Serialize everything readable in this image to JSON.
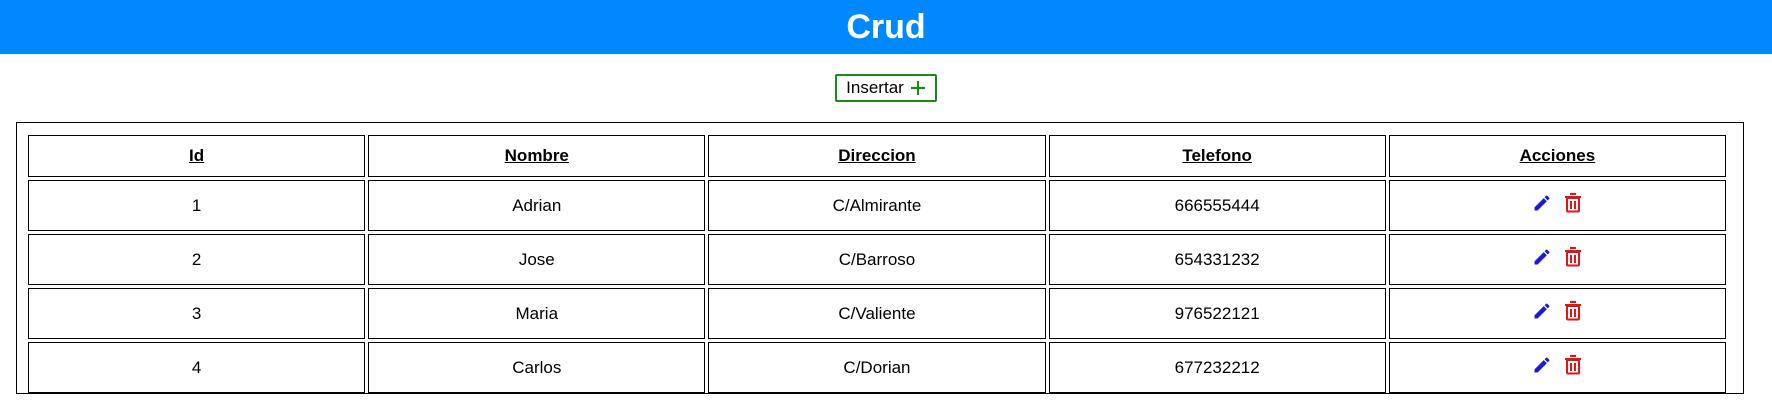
{
  "header": {
    "title": "Crud"
  },
  "toolbar": {
    "insert_label": "Insertar"
  },
  "table": {
    "columns": [
      "Id",
      "Nombre",
      "Direccion",
      "Telefono",
      "Acciones"
    ],
    "rows": [
      {
        "id": "1",
        "nombre": "Adrian",
        "direccion": "C/Almirante",
        "telefono": "666555444"
      },
      {
        "id": "2",
        "nombre": "Jose",
        "direccion": "C/Barroso",
        "telefono": "654331232"
      },
      {
        "id": "3",
        "nombre": "Maria",
        "direccion": "C/Valiente",
        "telefono": "976522121"
      },
      {
        "id": "4",
        "nombre": "Carlos",
        "direccion": "C/Dorian",
        "telefono": "677232212"
      }
    ]
  },
  "icons": {
    "add": "plus-icon",
    "edit": "pencil-icon",
    "delete": "trash-icon"
  },
  "colors": {
    "header_bg": "#0088ff",
    "insert_border": "#1a8a1a",
    "edit_icon": "#1a1adb",
    "delete_icon": "#e01414"
  }
}
